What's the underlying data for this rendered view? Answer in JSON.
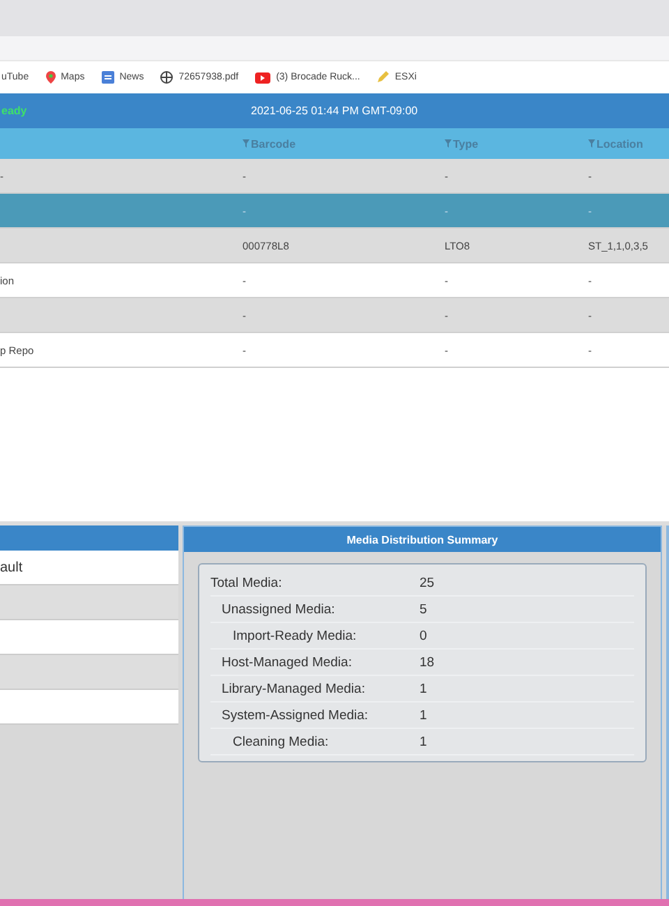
{
  "bookmarks": [
    {
      "label": "uTube",
      "kind": "none"
    },
    {
      "label": "Maps",
      "kind": "pin"
    },
    {
      "label": "News",
      "kind": "news"
    },
    {
      "label": "72657938.pdf",
      "kind": "globe"
    },
    {
      "label": "(3) Brocade Ruck...",
      "kind": "video"
    },
    {
      "label": "ESXi",
      "kind": "pencil"
    }
  ],
  "header": {
    "status": "eady",
    "datetime": "2021-06-25 01:44 PM GMT-09:00"
  },
  "table": {
    "columns": [
      "Barcode",
      "Type",
      "Location"
    ],
    "rows": [
      {
        "name": "-",
        "cells": [
          "-",
          "-",
          "-"
        ],
        "selected": false
      },
      {
        "cells": [
          "-",
          "-",
          "-"
        ],
        "selected": true
      },
      {
        "cells": [
          "000778L8",
          "LTO8",
          "ST_1,1,0,3,5"
        ],
        "selected": false
      },
      {
        "name": "ion",
        "cells": [
          "-",
          "-",
          "-"
        ],
        "selected": false
      },
      {
        "cells": [
          "-",
          "-",
          "-"
        ],
        "selected": false
      },
      {
        "name": "p Repo",
        "cells": [
          "-",
          "-",
          "-"
        ],
        "selected": false
      }
    ]
  },
  "left_panel": {
    "items": [
      {
        "label": "ault"
      }
    ]
  },
  "summary": {
    "title": "Media Distribution Summary",
    "items": [
      {
        "label": "Total Media:",
        "value": "25",
        "children": [
          {
            "label": "Unassigned Media:",
            "value": "5",
            "children": [
              {
                "label": "Import-Ready Media:",
                "value": "0"
              }
            ]
          },
          {
            "label": "Host-Managed Media:",
            "value": "18"
          },
          {
            "label": "Library-Managed Media:",
            "value": "1"
          },
          {
            "label": "System-Assigned Media:",
            "value": "1",
            "children": [
              {
                "label": "Cleaning Media:",
                "value": "1"
              }
            ]
          }
        ]
      }
    ]
  }
}
